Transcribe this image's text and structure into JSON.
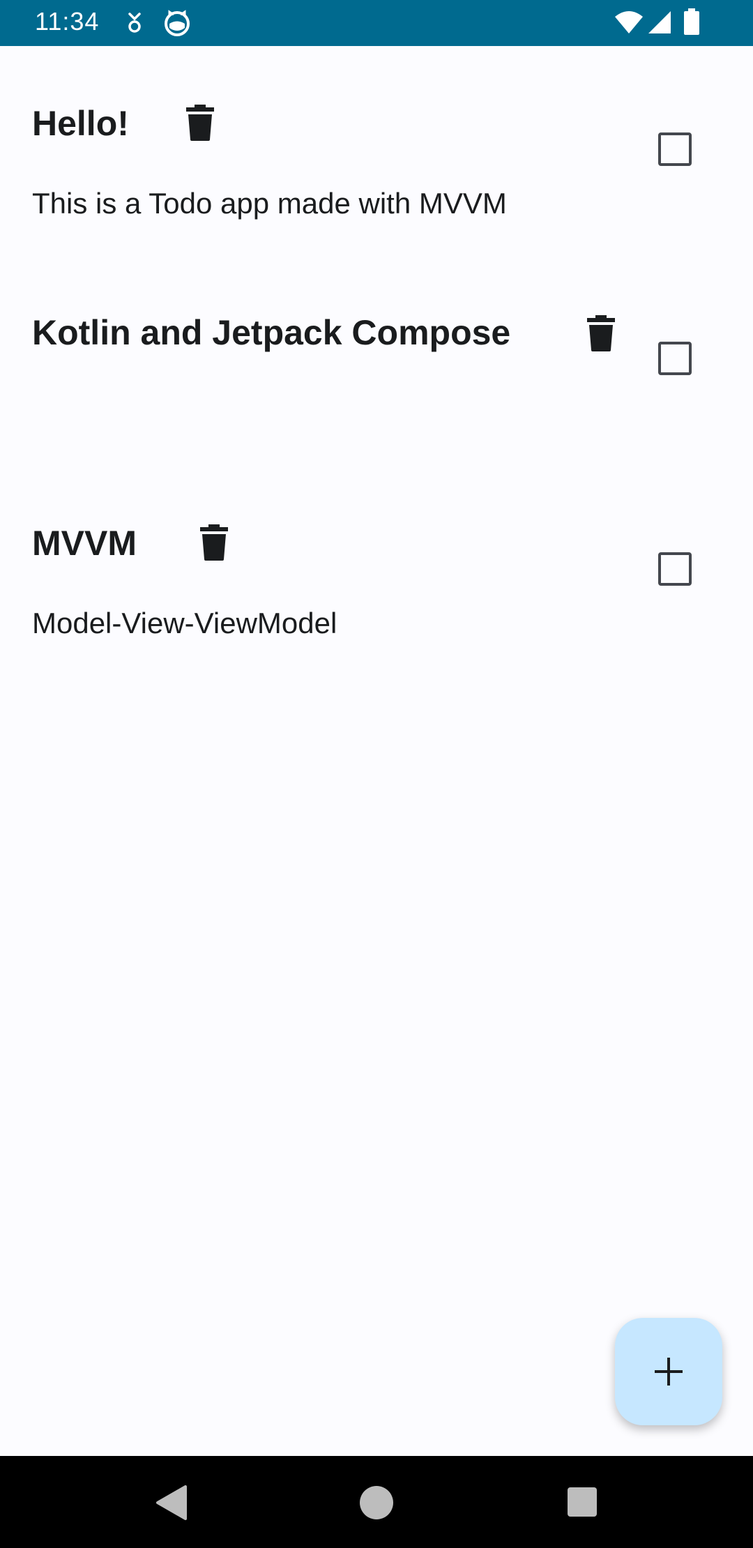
{
  "status_bar": {
    "time": "11:34",
    "icons": [
      "notification-icon",
      "cat-icon",
      "wifi-icon",
      "signal-icon",
      "battery-icon"
    ]
  },
  "todos": [
    {
      "title": "Hello!",
      "description": "This is a Todo app made with MVVM",
      "checked": false
    },
    {
      "title": "Kotlin and Jetpack Compose",
      "description": "",
      "checked": false
    },
    {
      "title": "MVVM",
      "description": "Model-View-ViewModel",
      "checked": false
    }
  ],
  "fab": {
    "icon": "plus-icon"
  },
  "nav_bar": {
    "icons": [
      "back-icon",
      "home-icon",
      "recents-icon"
    ]
  },
  "colors": {
    "status_bar": "#006a8f",
    "fab": "#c6e7ff",
    "background": "#fcfcff",
    "text": "#1a1c1e"
  }
}
